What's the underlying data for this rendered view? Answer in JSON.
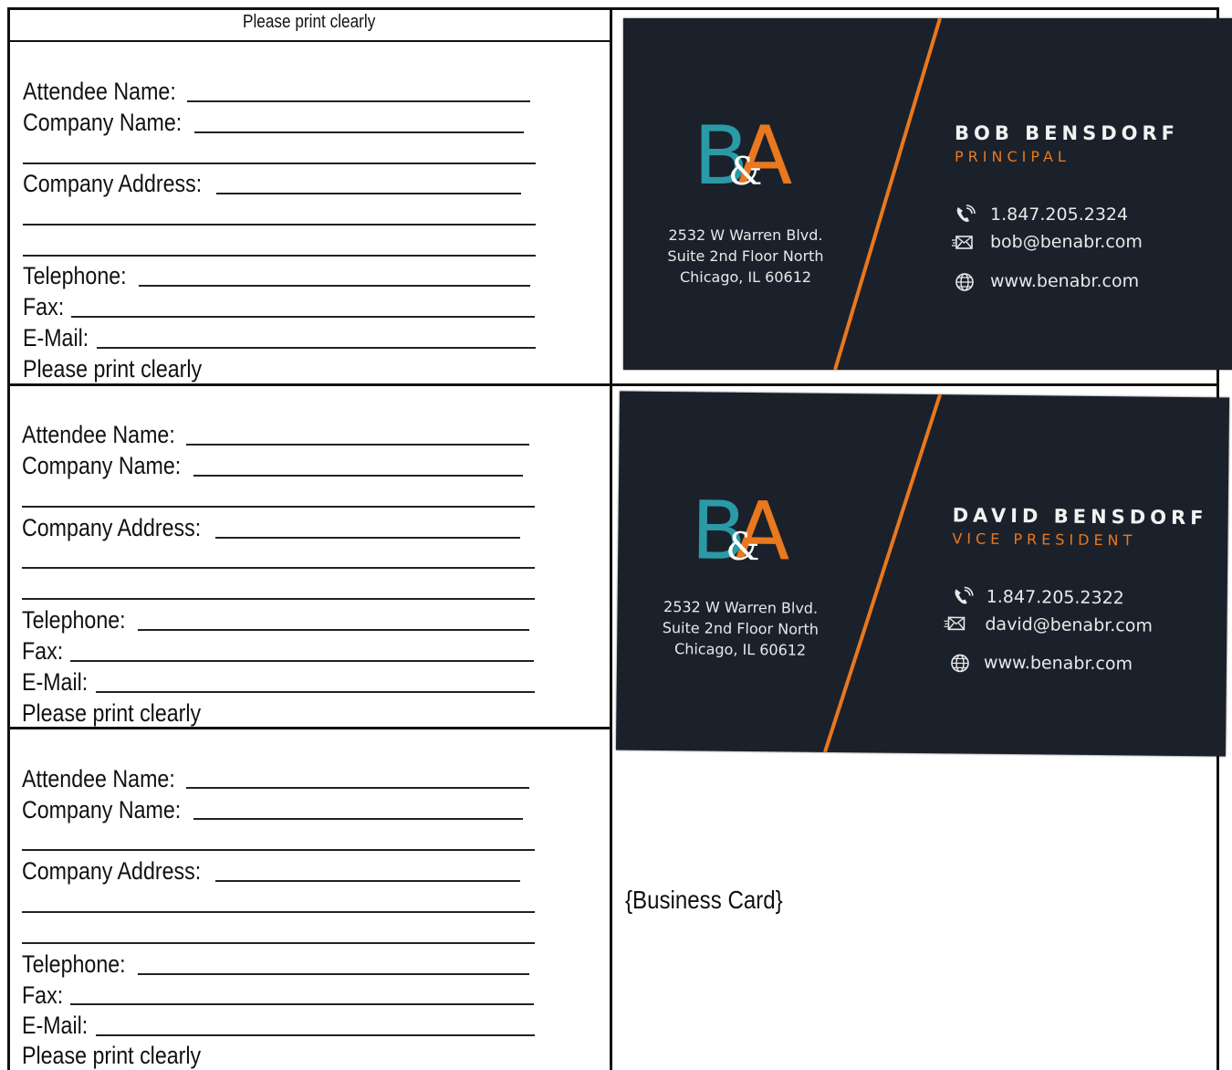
{
  "header": {
    "instruction": "Please print clearly"
  },
  "forms": [
    {
      "attendee_label": "Attendee Name:",
      "company_label": "Company Name:",
      "address_label": "Company Address:",
      "telephone_label": "Telephone:",
      "fax_label": "Fax:",
      "email_label": "E-Mail:",
      "footer": "Please print clearly"
    },
    {
      "attendee_label": "Attendee Name:",
      "company_label": "Company Name:",
      "address_label": "Company Address:",
      "telephone_label": "Telephone:",
      "fax_label": "Fax:",
      "email_label": "E-Mail:",
      "footer": "Please print clearly"
    },
    {
      "attendee_label": "Attendee Name:",
      "company_label": "Company Name:",
      "address_label": "Company Address:",
      "telephone_label": "Telephone:",
      "fax_label": "Fax:",
      "email_label": "E-Mail:",
      "footer": "Please print clearly"
    }
  ],
  "cards": [
    {
      "logo": {
        "b": "B",
        "amp": "&",
        "a": "A"
      },
      "address": [
        "2532 W Warren Blvd.",
        "Suite 2nd Floor North",
        "Chicago, IL 60612"
      ],
      "name": "BOB BENSDORF",
      "role": "PRINCIPAL",
      "phone": "1.847.205.2324",
      "email": "bob@benabr.com",
      "web": "www.benabr.com"
    },
    {
      "logo": {
        "b": "B",
        "amp": "&",
        "a": "A"
      },
      "address": [
        "2532 W Warren Blvd.",
        "Suite 2nd Floor North",
        "Chicago, IL 60612"
      ],
      "name": "DAVID BENSDORF",
      "role": "VICE PRESIDENT",
      "phone": "1.847.205.2322",
      "email": "david@benabr.com",
      "web": "www.benabr.com"
    }
  ],
  "business_card_placeholder": "{Business Card}",
  "colors": {
    "card_bg": "#1b212b",
    "accent_orange": "#e9781e",
    "accent_teal": "#2a9aa6"
  }
}
